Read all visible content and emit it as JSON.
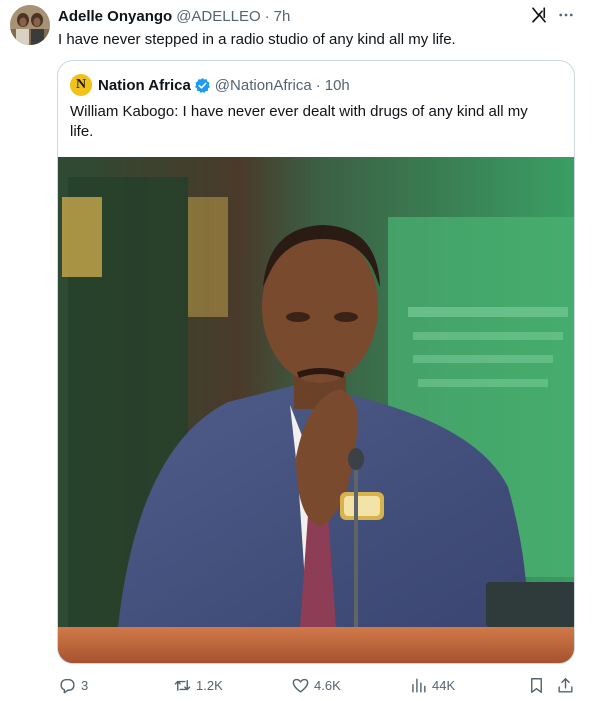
{
  "tweet": {
    "author_name": "Adelle Onyango",
    "author_handle": "@ADELLEO",
    "dot": "·",
    "time": "7h",
    "text": "I have never stepped in a radio studio of any kind all my life."
  },
  "quote": {
    "logo_letter": "N",
    "author_name": "Nation Africa",
    "author_handle": "@NationAfrica",
    "dot": "·",
    "time": "10h",
    "text": "William Kabogo: I have never ever dealt with drugs of any kind all my life."
  },
  "actions": {
    "replies": "3",
    "reposts": "1.2K",
    "likes": "4.6K",
    "views": "44K"
  },
  "icons": {
    "grok": "grok-icon",
    "more": "more-icon",
    "verified": "verified-badge-icon",
    "reply": "reply-icon",
    "repost": "repost-icon",
    "like": "heart-icon",
    "views": "views-icon",
    "bookmark": "bookmark-icon",
    "share": "share-icon"
  },
  "colors": {
    "text": "#0f1419",
    "secondary": "#536471",
    "border": "#cfd9de",
    "verified": "#1d9bf0",
    "nation_logo": "#f2c218"
  }
}
